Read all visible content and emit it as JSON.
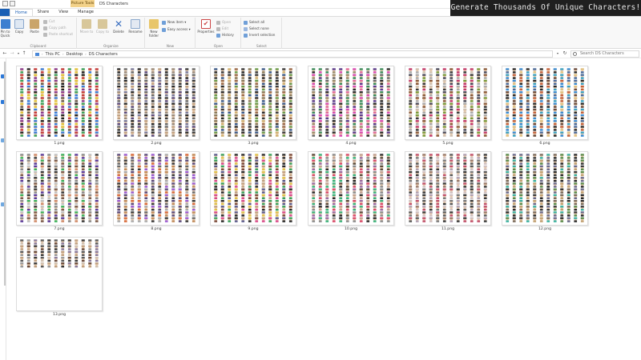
{
  "window": {
    "title": "DS Characters",
    "context_tab": "Picture Tools",
    "promo_banner": "Generate Thousands Of Unique Characters!"
  },
  "tabs": [
    {
      "label": "Home",
      "active": true
    },
    {
      "label": "Share",
      "active": false
    },
    {
      "label": "View",
      "active": false
    },
    {
      "label": "Manage",
      "active": false
    }
  ],
  "ribbon": {
    "clipboard": {
      "label": "Clipboard",
      "pin": "Pin to Quick access",
      "copy": "Copy",
      "paste": "Paste",
      "cut": "Cut",
      "copy_path": "Copy path",
      "paste_shortcut": "Paste shortcut"
    },
    "organize": {
      "label": "Organize",
      "move_to": "Move to",
      "copy_to": "Copy to",
      "delete": "Delete",
      "rename": "Rename"
    },
    "new": {
      "label": "New",
      "new_folder": "New folder",
      "new_item": "New item",
      "easy_access": "Easy access"
    },
    "open": {
      "label": "Open",
      "properties": "Properties",
      "open": "Open",
      "edit": "Edit",
      "history": "History"
    },
    "select": {
      "label": "Select",
      "select_all": "Select all",
      "select_none": "Select none",
      "invert_selection": "Invert selection"
    }
  },
  "address": {
    "crumbs": [
      "This PC",
      "Desktop",
      "DS Characters"
    ],
    "search_placeholder": "Search DS Characters"
  },
  "colors": {
    "accent": "#2b78d8",
    "context_tab": "#f3d28a",
    "promo_bg": "#1f1f1f"
  },
  "files": [
    {
      "name": "1.png",
      "palette": [
        "#c23a3a",
        "#3a7bd5",
        "#e2c23a",
        "#6a5a4a",
        "#3aa05a",
        "#8a3a8a",
        "#222222"
      ]
    },
    {
      "name": "2.png",
      "palette": [
        "#6a6a6a",
        "#3a3a3a",
        "#9a8a7a",
        "#5a4a7a",
        "#2a2a2a",
        "#c0a080",
        "#7a7a9a"
      ]
    },
    {
      "name": "3.png",
      "palette": [
        "#8a7a5a",
        "#3a3a3a",
        "#6a9a4a",
        "#3a5a8a",
        "#d0b070",
        "#2a2a2a",
        "#9a6a4a"
      ]
    },
    {
      "name": "4.png",
      "palette": [
        "#d84ab0",
        "#5a3a8a",
        "#3a8a5a",
        "#6a6a6a",
        "#e06a9a",
        "#2a2a2a",
        "#9a8a6a"
      ]
    },
    {
      "name": "5.png",
      "palette": [
        "#4a4a5a",
        "#c23a6a",
        "#7a9a3a",
        "#d0c0b0",
        "#3a3a3a",
        "#8a5a3a",
        "#aaaaaa"
      ]
    },
    {
      "name": "6.png",
      "palette": [
        "#3a8ad0",
        "#3aa0c0",
        "#c2603a",
        "#6a4a3a",
        "#e0c080",
        "#2a2a2a",
        "#4a6a9a"
      ]
    },
    {
      "name": "7.png",
      "palette": [
        "#3ab05a",
        "#5a3a9a",
        "#7a5a4a",
        "#c0c0c0",
        "#3a3a3a",
        "#d08a6a",
        "#8a8a8a"
      ]
    },
    {
      "name": "8.png",
      "palette": [
        "#9a5ad0",
        "#6a6a6a",
        "#3a3a3a",
        "#c08a5a",
        "#d86a3a",
        "#5a4a7a",
        "#aaaaaa"
      ]
    },
    {
      "name": "9.png",
      "palette": [
        "#d84a8a",
        "#3aa05a",
        "#e0c04a",
        "#7a4a3a",
        "#5a5a8a",
        "#2a2a2a",
        "#c0a080"
      ]
    },
    {
      "name": "10.png",
      "palette": [
        "#8a8a8a",
        "#d84a6a",
        "#3ab07a",
        "#5a4a3a",
        "#c0a090",
        "#2a2a2a",
        "#9a6aa0"
      ]
    },
    {
      "name": "11.png",
      "palette": [
        "#7a7a7a",
        "#b0a0b0",
        "#3a3a3a",
        "#c0506a",
        "#5a5a5a",
        "#d0c0c0",
        "#9a7a6a"
      ]
    },
    {
      "name": "12.png",
      "palette": [
        "#3a3a3a",
        "#5a8a4a",
        "#3ab0a0",
        "#7a6a5a",
        "#c0a070",
        "#6a6a8a",
        "#2a2a2a"
      ]
    },
    {
      "name": "13.png",
      "palette": [
        "#5a5a5a",
        "#c0a080",
        "#3a3a3a",
        "#8a7a9a",
        "#d0c0b0",
        "#6a4a3a",
        "#9a9a9a"
      ]
    }
  ]
}
